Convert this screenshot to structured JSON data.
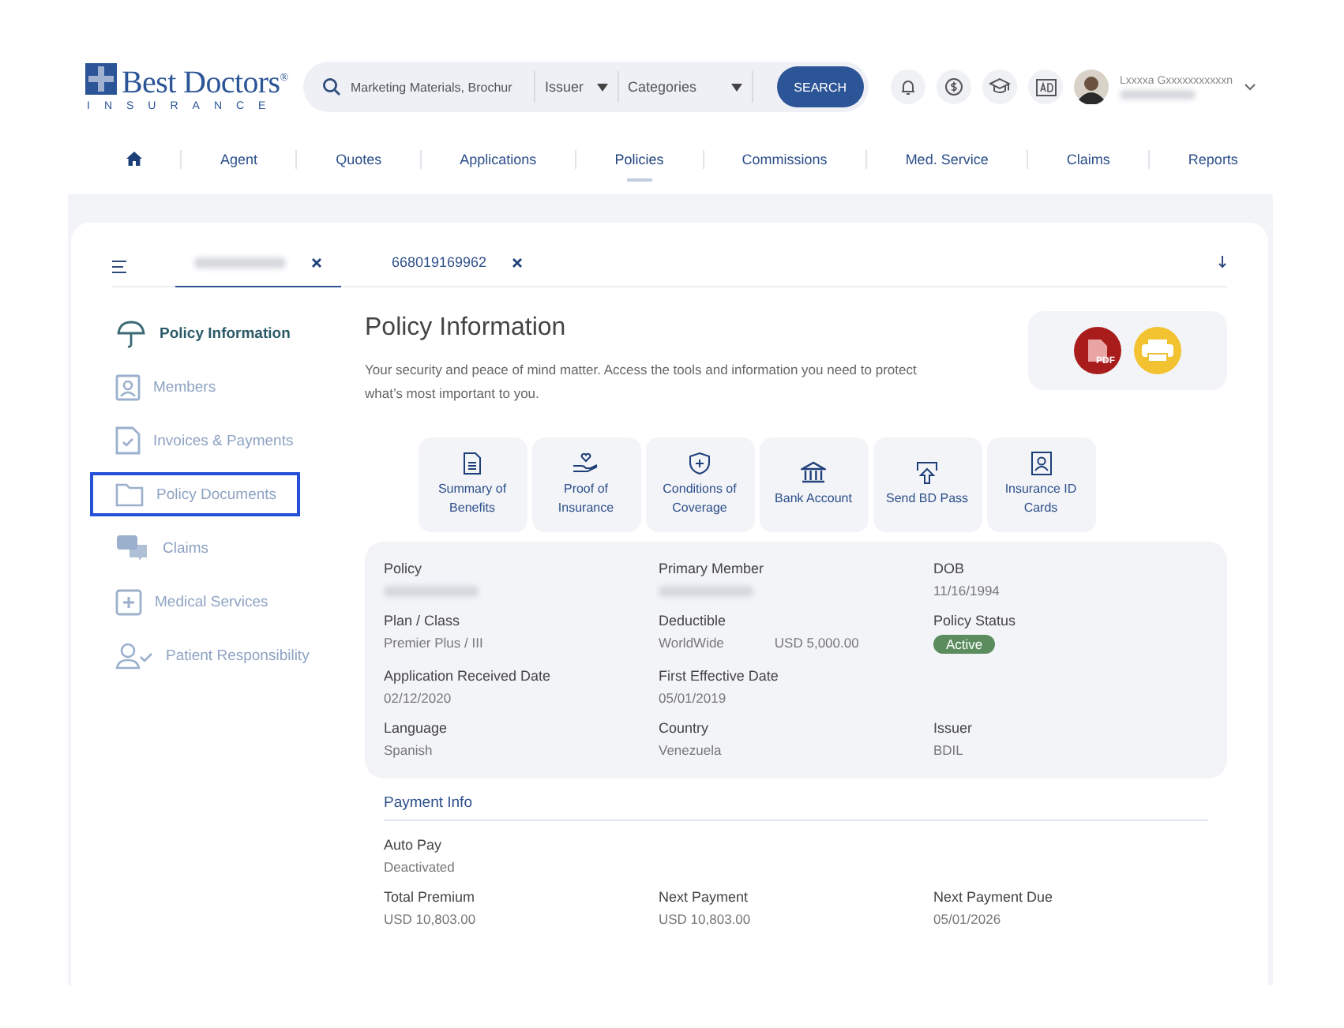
{
  "header": {
    "logo": {
      "name": "Best Doctors$^{®}$",
      "tagline": "INSURANCE"
    },
    "search": {
      "value": "Marketing Materials, Brochur",
      "issuer": "Issuer",
      "categories": "Categories",
      "button": "SEARCH"
    },
    "user": {
      "name": "Lxxxxa Gxxxxxxxxxxxn"
    }
  },
  "nav": [
    {
      "kind": "home",
      "selected": false
    },
    {
      "kind": "link",
      "label": "Agent",
      "selected": false
    },
    {
      "kind": "link",
      "label": "Quotes",
      "selected": false
    },
    {
      "kind": "link",
      "label": "Applications",
      "selected": false
    },
    {
      "kind": "link",
      "label": "Policies",
      "selected": true
    },
    {
      "kind": "link",
      "label": "Commissions",
      "selected": false
    },
    {
      "kind": "link",
      "label": "Med. Service",
      "selected": false
    },
    {
      "kind": "link",
      "label": "Claims",
      "selected": false
    },
    {
      "kind": "link",
      "label": "Reports",
      "selected": false
    }
  ],
  "tabs": [
    {
      "kind": "redacted",
      "selected": true
    },
    {
      "kind": "text",
      "label": "668019169962",
      "selected": false
    }
  ],
  "sidebar": {
    "items": [
      {
        "label": "Policy Information",
        "selected": true,
        "focused": false
      },
      {
        "label": "Members",
        "selected": false,
        "focused": false
      },
      {
        "label": "Invoices & Payments",
        "selected": false,
        "focused": false
      },
      {
        "label": "Policy Documents",
        "selected": false,
        "focused": true
      },
      {
        "label": "Claims",
        "selected": false,
        "focused": false
      },
      {
        "label": "Medical Services",
        "selected": false,
        "focused": false
      },
      {
        "label": "Patient Responsibility",
        "selected": false,
        "focused": false
      }
    ]
  },
  "page": {
    "title": "Policy Information",
    "intro": "Your security and peace of mind matter. Access the tools and information you need to protect what’s most important to you.",
    "pdf_label": "PDF"
  },
  "actions": [
    {
      "label": "Summary of Benefits"
    },
    {
      "label": "Proof of Insurance"
    },
    {
      "label": "Conditions of Coverage"
    },
    {
      "label": "Bank Account"
    },
    {
      "label": "Send BD Pass"
    },
    {
      "label": "Insurance ID Cards"
    }
  ],
  "details": [
    [
      {
        "label": "Policy",
        "kind": "redacted"
      },
      {
        "label": "Primary Member",
        "kind": "redacted"
      },
      {
        "label": "DOB",
        "kind": "text",
        "value": "11/16/1994"
      }
    ],
    [
      {
        "label": "Plan / Class",
        "kind": "text",
        "value": "Premier Plus / III"
      },
      {
        "label": "Deductible",
        "kind": "pair",
        "value": "WorldWide",
        "extra": "USD 5,000.00"
      },
      {
        "label": "Policy Status",
        "kind": "badge",
        "value": "Active"
      }
    ],
    [
      {
        "label": "Application Received Date",
        "kind": "text",
        "value": "02/12/2020"
      },
      {
        "label": "First Effective Date",
        "kind": "text",
        "value": "05/01/2019"
      }
    ],
    [
      {
        "label": "Language",
        "kind": "text",
        "value": "Spanish"
      },
      {
        "label": "Country",
        "kind": "text",
        "value": "Venezuela"
      },
      {
        "label": "Issuer",
        "kind": "text",
        "value": "BDIL"
      }
    ]
  ],
  "payment": {
    "title": "Payment Info",
    "rows": [
      [
        {
          "label": "Auto Pay",
          "value": "Deactivated"
        }
      ],
      [
        {
          "label": "Total Premium",
          "value": "USD 10,803.00"
        },
        {
          "label": "Next Payment",
          "value": "USD 10,803.00"
        },
        {
          "label": "Next Payment Due",
          "value": "05/01/2026"
        }
      ]
    ]
  }
}
